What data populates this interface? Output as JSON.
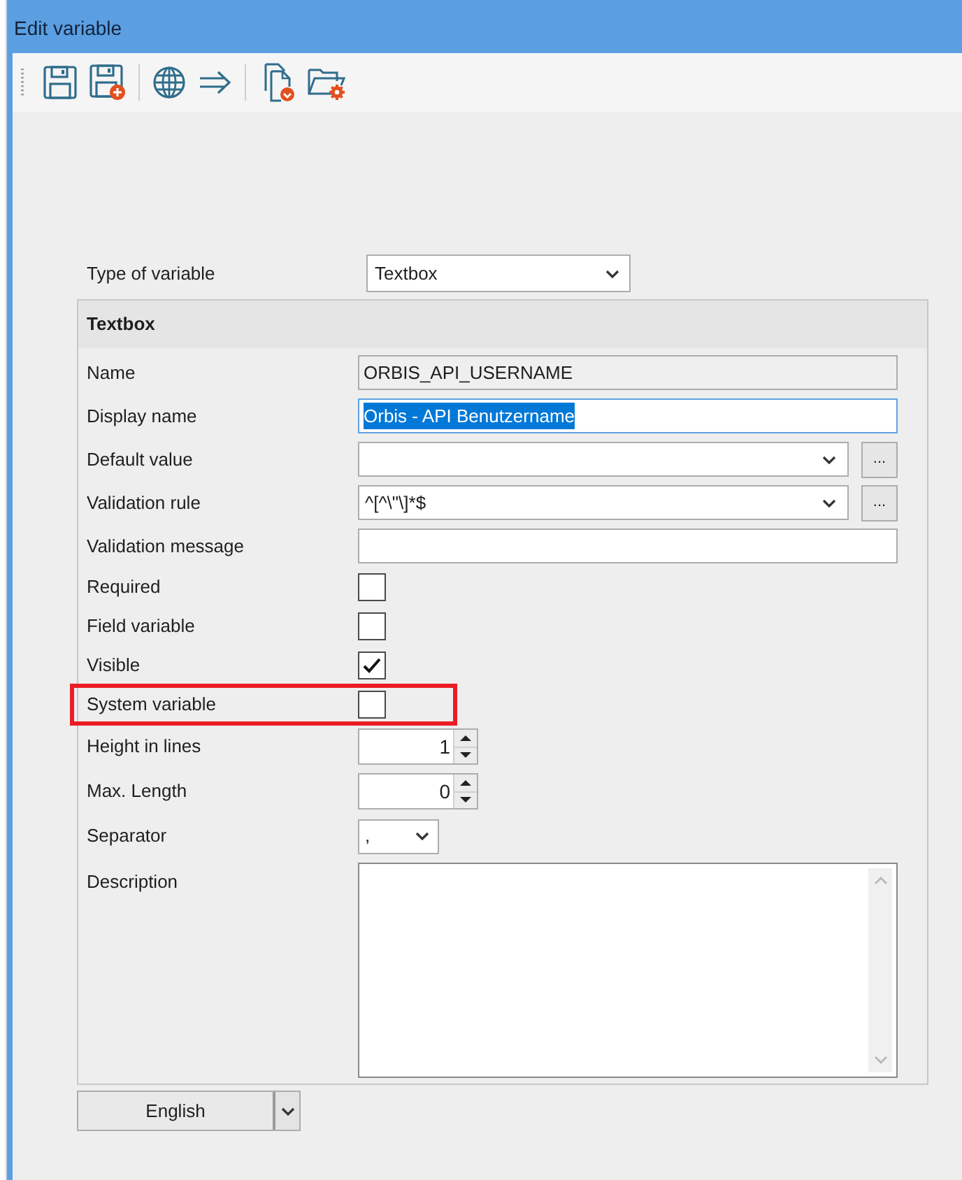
{
  "window": {
    "title": "Edit variable"
  },
  "type_of_variable": {
    "label": "Type of variable",
    "value": "Textbox"
  },
  "group": {
    "title": "Textbox",
    "fields": [
      {
        "kind": "text",
        "label": "Name",
        "value": "ORBIS_API_USERNAME",
        "readonly": true,
        "focused": false
      },
      {
        "kind": "text",
        "label": "Display name",
        "value": "Orbis - API Benutzername",
        "readonly": false,
        "focused": true
      },
      {
        "kind": "dropdown",
        "label": "Default value",
        "button": "..."
      },
      {
        "kind": "dropdown",
        "label": "Validation rule",
        "value": "^[^\\\"\\]*$",
        "button": "..."
      },
      {
        "kind": "text",
        "label": "Validation message",
        "readonly": false,
        "focused": false
      },
      {
        "kind": "checkbox",
        "label": "Required",
        "checked": false,
        "highlighted": false
      },
      {
        "kind": "checkbox",
        "label": "Field variable",
        "checked": false,
        "highlighted": false
      },
      {
        "kind": "checkbox",
        "label": "Visible",
        "checked": true,
        "highlighted": false
      },
      {
        "kind": "checkbox",
        "label": "System variable",
        "checked": false,
        "highlighted": true
      },
      {
        "kind": "spinner",
        "label": "Height in lines",
        "value": "1"
      },
      {
        "kind": "spinner",
        "label": "Max. Length",
        "value": "0"
      },
      {
        "kind": "short_dropdown",
        "label": "Separator",
        "value": ","
      },
      {
        "kind": "textarea",
        "label": "Description"
      }
    ]
  },
  "language": {
    "value": "English"
  }
}
